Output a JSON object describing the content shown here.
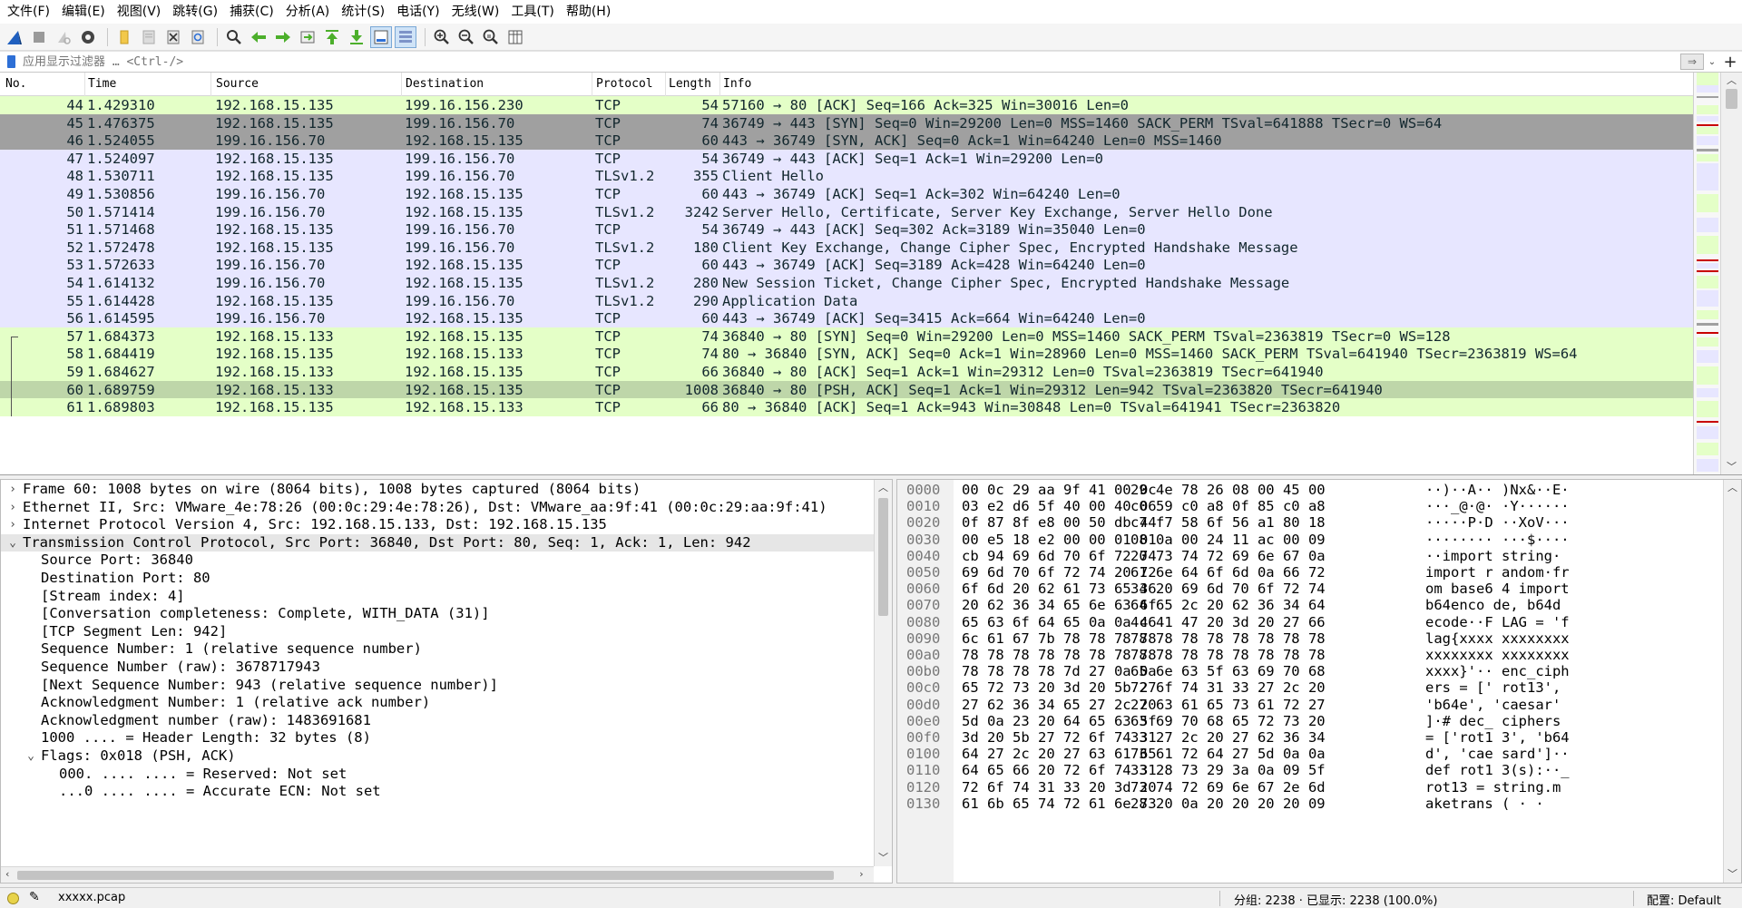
{
  "menubar": {
    "items": [
      "文件(F)",
      "编辑(E)",
      "视图(V)",
      "跳转(G)",
      "捕获(C)",
      "分析(A)",
      "统计(S)",
      "电话(Y)",
      "无线(W)",
      "工具(T)",
      "帮助(H)"
    ]
  },
  "toolbar": {
    "icons": [
      "shark-fin-start-icon",
      "stop-square-icon",
      "restart-icon",
      "capture-options-icon",
      "open-folder-icon",
      "save-file-icon",
      "close-file-icon",
      "reload-icon",
      "find-packet-icon",
      "go-back-icon",
      "go-forward-icon",
      "go-to-packet-icon",
      "go-first-icon",
      "go-last-icon",
      "autoscroll-icon",
      "colorize-icon",
      "zoom-in-icon",
      "zoom-out-icon",
      "zoom-normal-icon",
      "resize-columns-icon"
    ]
  },
  "filter": {
    "placeholder": "应用显示过滤器 … <Ctrl-/>"
  },
  "packet_list": {
    "columns": [
      "No.",
      "Time",
      "Source",
      "Destination",
      "Protocol",
      "Length",
      "Info"
    ],
    "rows": [
      {
        "no": "44",
        "time": "1.429310",
        "src": "192.168.15.135",
        "dst": "199.16.156.230",
        "proto": "TCP",
        "len": "54",
        "info": "57160 → 80 [ACK] Seq=166 Ack=325 Win=30016 Len=0",
        "bg": "#e4ffc7",
        "fg": "#12272e"
      },
      {
        "no": "45",
        "time": "1.476375",
        "src": "192.168.15.135",
        "dst": "199.16.156.70",
        "proto": "TCP",
        "len": "74",
        "info": "36749 → 443 [SYN] Seq=0 Win=29200 Len=0 MSS=1460 SACK_PERM TSval=641888 TSecr=0 WS=64",
        "bg": "#a0a0a0",
        "fg": "#12272e"
      },
      {
        "no": "46",
        "time": "1.524055",
        "src": "199.16.156.70",
        "dst": "192.168.15.135",
        "proto": "TCP",
        "len": "60",
        "info": "443 → 36749 [SYN, ACK] Seq=0 Ack=1 Win=64240 Len=0 MSS=1460",
        "bg": "#a0a0a0",
        "fg": "#12272e"
      },
      {
        "no": "47",
        "time": "1.524097",
        "src": "192.168.15.135",
        "dst": "199.16.156.70",
        "proto": "TCP",
        "len": "54",
        "info": "36749 → 443 [ACK] Seq=1 Ack=1 Win=29200 Len=0",
        "bg": "#e7e6ff",
        "fg": "#12272e"
      },
      {
        "no": "48",
        "time": "1.530711",
        "src": "192.168.15.135",
        "dst": "199.16.156.70",
        "proto": "TLSv1.2",
        "len": "355",
        "info": "Client Hello",
        "bg": "#e7e6ff",
        "fg": "#12272e"
      },
      {
        "no": "49",
        "time": "1.530856",
        "src": "199.16.156.70",
        "dst": "192.168.15.135",
        "proto": "TCP",
        "len": "60",
        "info": "443 → 36749 [ACK] Seq=1 Ack=302 Win=64240 Len=0",
        "bg": "#e7e6ff",
        "fg": "#12272e"
      },
      {
        "no": "50",
        "time": "1.571414",
        "src": "199.16.156.70",
        "dst": "192.168.15.135",
        "proto": "TLSv1.2",
        "len": "3242",
        "info": "Server Hello, Certificate, Server Key Exchange, Server Hello Done",
        "bg": "#e7e6ff",
        "fg": "#12272e"
      },
      {
        "no": "51",
        "time": "1.571468",
        "src": "192.168.15.135",
        "dst": "199.16.156.70",
        "proto": "TCP",
        "len": "54",
        "info": "36749 → 443 [ACK] Seq=302 Ack=3189 Win=35040 Len=0",
        "bg": "#e7e6ff",
        "fg": "#12272e"
      },
      {
        "no": "52",
        "time": "1.572478",
        "src": "192.168.15.135",
        "dst": "199.16.156.70",
        "proto": "TLSv1.2",
        "len": "180",
        "info": "Client Key Exchange, Change Cipher Spec, Encrypted Handshake Message",
        "bg": "#e7e6ff",
        "fg": "#12272e"
      },
      {
        "no": "53",
        "time": "1.572633",
        "src": "199.16.156.70",
        "dst": "192.168.15.135",
        "proto": "TCP",
        "len": "60",
        "info": "443 → 36749 [ACK] Seq=3189 Ack=428 Win=64240 Len=0",
        "bg": "#e7e6ff",
        "fg": "#12272e"
      },
      {
        "no": "54",
        "time": "1.614132",
        "src": "199.16.156.70",
        "dst": "192.168.15.135",
        "proto": "TLSv1.2",
        "len": "280",
        "info": "New Session Ticket, Change Cipher Spec, Encrypted Handshake Message",
        "bg": "#e7e6ff",
        "fg": "#12272e"
      },
      {
        "no": "55",
        "time": "1.614428",
        "src": "192.168.15.135",
        "dst": "199.16.156.70",
        "proto": "TLSv1.2",
        "len": "290",
        "info": "Application Data",
        "bg": "#e7e6ff",
        "fg": "#12272e"
      },
      {
        "no": "56",
        "time": "1.614595",
        "src": "199.16.156.70",
        "dst": "192.168.15.135",
        "proto": "TCP",
        "len": "60",
        "info": "443 → 36749 [ACK] Seq=3415 Ack=664 Win=64240 Len=0",
        "bg": "#e7e6ff",
        "fg": "#12272e"
      },
      {
        "no": "57",
        "time": "1.684373",
        "src": "192.168.15.133",
        "dst": "192.168.15.135",
        "proto": "TCP",
        "len": "74",
        "info": "36840 → 80 [SYN] Seq=0 Win=29200 Len=0 MSS=1460 SACK_PERM TSval=2363819 TSecr=0 WS=128",
        "bg": "#e4ffc7",
        "fg": "#12272e"
      },
      {
        "no": "58",
        "time": "1.684419",
        "src": "192.168.15.135",
        "dst": "192.168.15.133",
        "proto": "TCP",
        "len": "74",
        "info": "80 → 36840 [SYN, ACK] Seq=0 Ack=1 Win=28960 Len=0 MSS=1460 SACK_PERM TSval=641940 TSecr=2363819 WS=64",
        "bg": "#e4ffc7",
        "fg": "#12272e"
      },
      {
        "no": "59",
        "time": "1.684627",
        "src": "192.168.15.133",
        "dst": "192.168.15.135",
        "proto": "TCP",
        "len": "66",
        "info": "36840 → 80 [ACK] Seq=1 Ack=1 Win=29312 Len=0 TSval=2363819 TSecr=641940",
        "bg": "#e4ffc7",
        "fg": "#12272e"
      },
      {
        "no": "60",
        "time": "1.689759",
        "src": "192.168.15.133",
        "dst": "192.168.15.135",
        "proto": "TCP",
        "len": "1008",
        "info": "36840 → 80 [PSH, ACK] Seq=1 Ack=1 Win=29312 Len=942 TSval=2363820 TSecr=641940",
        "bg": "#bed6a9",
        "fg": "#12272e"
      },
      {
        "no": "61",
        "time": "1.689803",
        "src": "192.168.15.135",
        "dst": "192.168.15.133",
        "proto": "TCP",
        "len": "66",
        "info": "80 → 36840 [ACK] Seq=1 Ack=943 Win=30848 Len=0 TSval=641941 TSecr=2363820",
        "bg": "#e4ffc7",
        "fg": "#12272e"
      }
    ]
  },
  "details": {
    "lines": [
      {
        "text": "Frame 60: 1008 bytes on wire (8064 bits), 1008 bytes captured (8064 bits)",
        "indent": 0,
        "tw": "›"
      },
      {
        "text": "Ethernet II, Src: VMware_4e:78:26 (00:0c:29:4e:78:26), Dst: VMware_aa:9f:41 (00:0c:29:aa:9f:41)",
        "indent": 0,
        "tw": "›"
      },
      {
        "text": "Internet Protocol Version 4, Src: 192.168.15.133, Dst: 192.168.15.135",
        "indent": 0,
        "tw": "›"
      },
      {
        "text": "Transmission Control Protocol, Src Port: 36840, Dst Port: 80, Seq: 1, Ack: 1, Len: 942",
        "indent": 0,
        "tw": "⌄",
        "sel": true
      },
      {
        "text": "Source Port: 36840",
        "indent": 1,
        "tw": ""
      },
      {
        "text": "Destination Port: 80",
        "indent": 1,
        "tw": ""
      },
      {
        "text": "[Stream index: 4]",
        "indent": 1,
        "tw": ""
      },
      {
        "text": "[Conversation completeness: Complete, WITH_DATA (31)]",
        "indent": 1,
        "tw": ""
      },
      {
        "text": "[TCP Segment Len: 942]",
        "indent": 1,
        "tw": ""
      },
      {
        "text": "Sequence Number: 1    (relative sequence number)",
        "indent": 1,
        "tw": ""
      },
      {
        "text": "Sequence Number (raw): 3678717943",
        "indent": 1,
        "tw": ""
      },
      {
        "text": "[Next Sequence Number: 943    (relative sequence number)]",
        "indent": 1,
        "tw": ""
      },
      {
        "text": "Acknowledgment Number: 1    (relative ack number)",
        "indent": 1,
        "tw": ""
      },
      {
        "text": "Acknowledgment number (raw): 1483691681",
        "indent": 1,
        "tw": ""
      },
      {
        "text": "1000 .... = Header Length: 32 bytes (8)",
        "indent": 1,
        "tw": ""
      },
      {
        "text": "Flags: 0x018 (PSH, ACK)",
        "indent": 1,
        "tw": "⌄"
      },
      {
        "text": "000. .... .... = Reserved: Not set",
        "indent": 2,
        "tw": ""
      },
      {
        "text": "...0 .... .... = Accurate ECN: Not set",
        "indent": 2,
        "tw": ""
      }
    ]
  },
  "bytes": {
    "lines": [
      {
        "off": "0000",
        "a": "00 0c 29 aa 9f 41 00 0c",
        "b": "29 4e 78 26 08 00 45 00",
        "asc": "··)··A·· )Nx&··E·"
      },
      {
        "off": "0010",
        "a": "03 e2 d6 5f 40 00 40 06",
        "b": "c0 59 c0 a8 0f 85 c0 a8",
        "asc": "···_@·@· ·Y······"
      },
      {
        "off": "0020",
        "a": "0f 87 8f e8 00 50 db 44",
        "b": "c7 f7 58 6f 56 a1 80 18",
        "asc": "·····P·D ··XoV···"
      },
      {
        "off": "0030",
        "a": "00 e5 18 e2 00 00 01 01",
        "b": "08 0a 00 24 11 ac 00 09",
        "asc": "········ ···$····"
      },
      {
        "off": "0040",
        "a": "cb 94 69 6d 70 6f 72 74",
        "b": "20 73 74 72 69 6e 67 0a",
        "asc": "··import  string·"
      },
      {
        "off": "0050",
        "a": "69 6d 70 6f 72 74 20 72",
        "b": "61 6e 64 6f 6d 0a 66 72",
        "asc": "import r andom·fr"
      },
      {
        "off": "0060",
        "a": "6f 6d 20 62 61 73 65 36",
        "b": "34 20 69 6d 70 6f 72 74",
        "asc": "om base6 4 import"
      },
      {
        "off": "0070",
        "a": "20 62 36 34 65 6e 63 6f",
        "b": "64 65 2c 20 62 36 34 64",
        "asc": " b64enco de, b64d"
      },
      {
        "off": "0080",
        "a": "65 63 6f 64 65 0a 0a 46",
        "b": "4c 41 47 20 3d 20 27 66",
        "asc": "ecode··F LAG = 'f"
      },
      {
        "off": "0090",
        "a": "6c 61 67 7b 78 78 78 78",
        "b": "78 78 78 78 78 78 78 78",
        "asc": "lag{xxxx xxxxxxxx"
      },
      {
        "off": "00a0",
        "a": "78 78 78 78 78 78 78 78",
        "b": "78 78 78 78 78 78 78 78",
        "asc": "xxxxxxxx xxxxxxxx"
      },
      {
        "off": "00b0",
        "a": "78 78 78 78 7d 27 0a 0a",
        "b": "65 6e 63 5f 63 69 70 68",
        "asc": "xxxx}'·· enc_ciph"
      },
      {
        "off": "00c0",
        "a": "65 72 73 20 3d 20 5b 27",
        "b": "72 6f 74 31 33 27 2c 20",
        "asc": "ers = [' rot13', "
      },
      {
        "off": "00d0",
        "a": "27 62 36 34 65 27 2c 20",
        "b": "27 63 61 65 73 61 72 27",
        "asc": "'b64e',  'caesar'"
      },
      {
        "off": "00e0",
        "a": "5d 0a 23 20 64 65 63 5f",
        "b": "63 69 70 68 65 72 73 20",
        "asc": "]·# dec_ ciphers "
      },
      {
        "off": "00f0",
        "a": "3d 20 5b 27 72 6f 74 31",
        "b": "33 27 2c 20 27 62 36 34",
        "asc": "= ['rot1 3', 'b64"
      },
      {
        "off": "0100",
        "a": "64 27 2c 20 27 63 61 65",
        "b": "73 61 72 64 27 5d 0a 0a",
        "asc": "d', 'cae sard']··"
      },
      {
        "off": "0110",
        "a": "64 65 66 20 72 6f 74 31",
        "b": "33 28 73 29 3a 0a 09 5f",
        "asc": "def rot1 3(s):··_"
      },
      {
        "off": "0120",
        "a": "72 6f 74 31 33 20 3d 20",
        "b": "73 74 72 69 6e 67 2e 6d",
        "asc": "rot13 =  string.m"
      },
      {
        "off": "0130",
        "a": "61 6b 65 74 72 61 6e 73",
        "b": "28 20 0a 20 20 20 20 09",
        "asc": "aketrans ( ·    ·"
      }
    ]
  },
  "status": {
    "file": "xxxxx.pcap",
    "packets": "分组: 2238 · 已显示: 2238 (100.0%)",
    "profile": "配置: Default"
  }
}
